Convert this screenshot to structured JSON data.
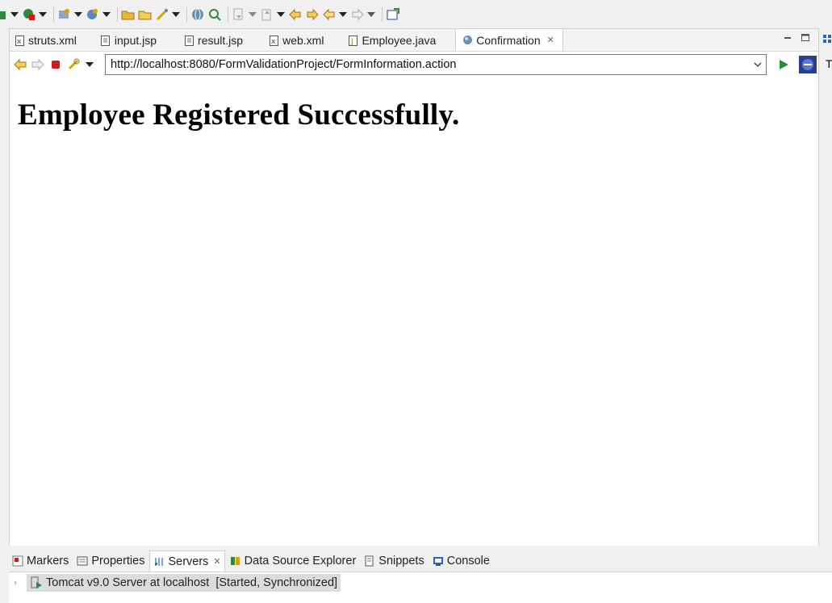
{
  "editor_tabs": [
    {
      "label": "struts.xml",
      "icon": "xml-file-icon"
    },
    {
      "label": "input.jsp",
      "icon": "jsp-file-icon"
    },
    {
      "label": "result.jsp",
      "icon": "jsp-file-icon"
    },
    {
      "label": "web.xml",
      "icon": "xml-file-icon"
    },
    {
      "label": "Employee.java",
      "icon": "java-file-icon"
    },
    {
      "label": "Confirmation",
      "icon": "globe-icon",
      "active": true
    }
  ],
  "browser": {
    "url": "http://localhost:8080/FormValidationProject/FormInformation.action"
  },
  "page": {
    "heading": "Employee Registered Successfully."
  },
  "right_pane": {
    "letter": "T"
  },
  "bottom_tabs": [
    {
      "label": "Markers",
      "icon": "markers-icon"
    },
    {
      "label": "Properties",
      "icon": "properties-icon"
    },
    {
      "label": "Servers",
      "icon": "servers-icon",
      "active": true
    },
    {
      "label": "Data Source Explorer",
      "icon": "data-source-icon"
    },
    {
      "label": "Snippets",
      "icon": "snippets-icon"
    },
    {
      "label": "Console",
      "icon": "console-icon"
    }
  ],
  "servers": [
    {
      "label": "Tomcat v9.0 Server at localhost  [Started, Synchronized]"
    }
  ],
  "colors": {
    "accent_green": "#2e8b3d",
    "stop_red": "#d11a1a",
    "toolbar_yellow": "#d9a400",
    "go_blue": "#2a3e8c"
  }
}
